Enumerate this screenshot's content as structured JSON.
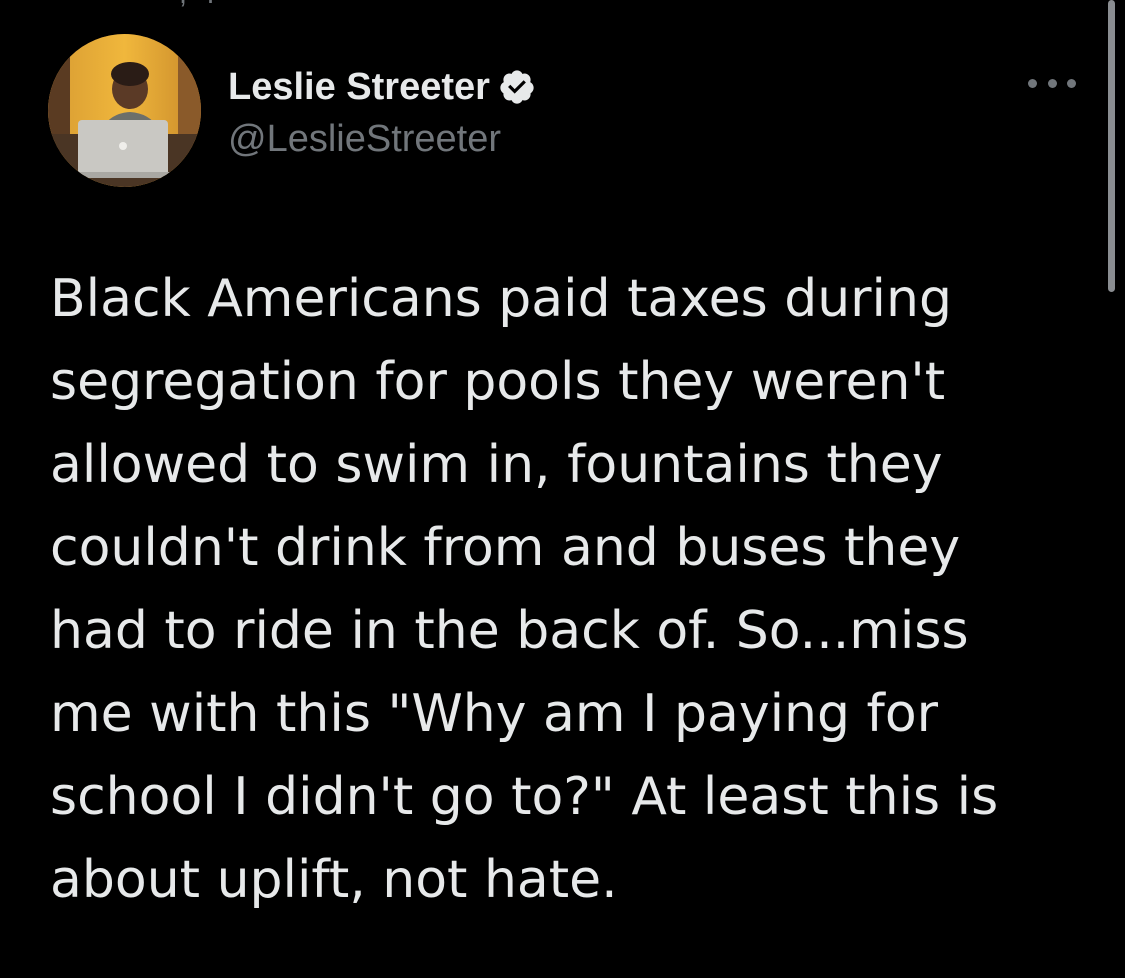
{
  "tweet": {
    "author": {
      "name": "Leslie Streeter",
      "handle": "@LeslieStreeter",
      "verified": true
    },
    "lines": [
      "Black Americans paid taxes during",
      "segregation for pools they weren't",
      "allowed to swim in, fountains they",
      "couldn't drink from and buses they",
      "had to ride in the back of. So...miss",
      "me with this \"Why am I paying for",
      "school I didn't go to?\" At least this is",
      "about uplift, not hate."
    ]
  },
  "icons": {
    "verified": "verified-badge-icon",
    "more": "more-options-icon"
  },
  "colors": {
    "background": "#000000",
    "text_primary": "#e7e9ea",
    "text_secondary": "#71767b",
    "verified_badge": "#e7e9ea"
  }
}
